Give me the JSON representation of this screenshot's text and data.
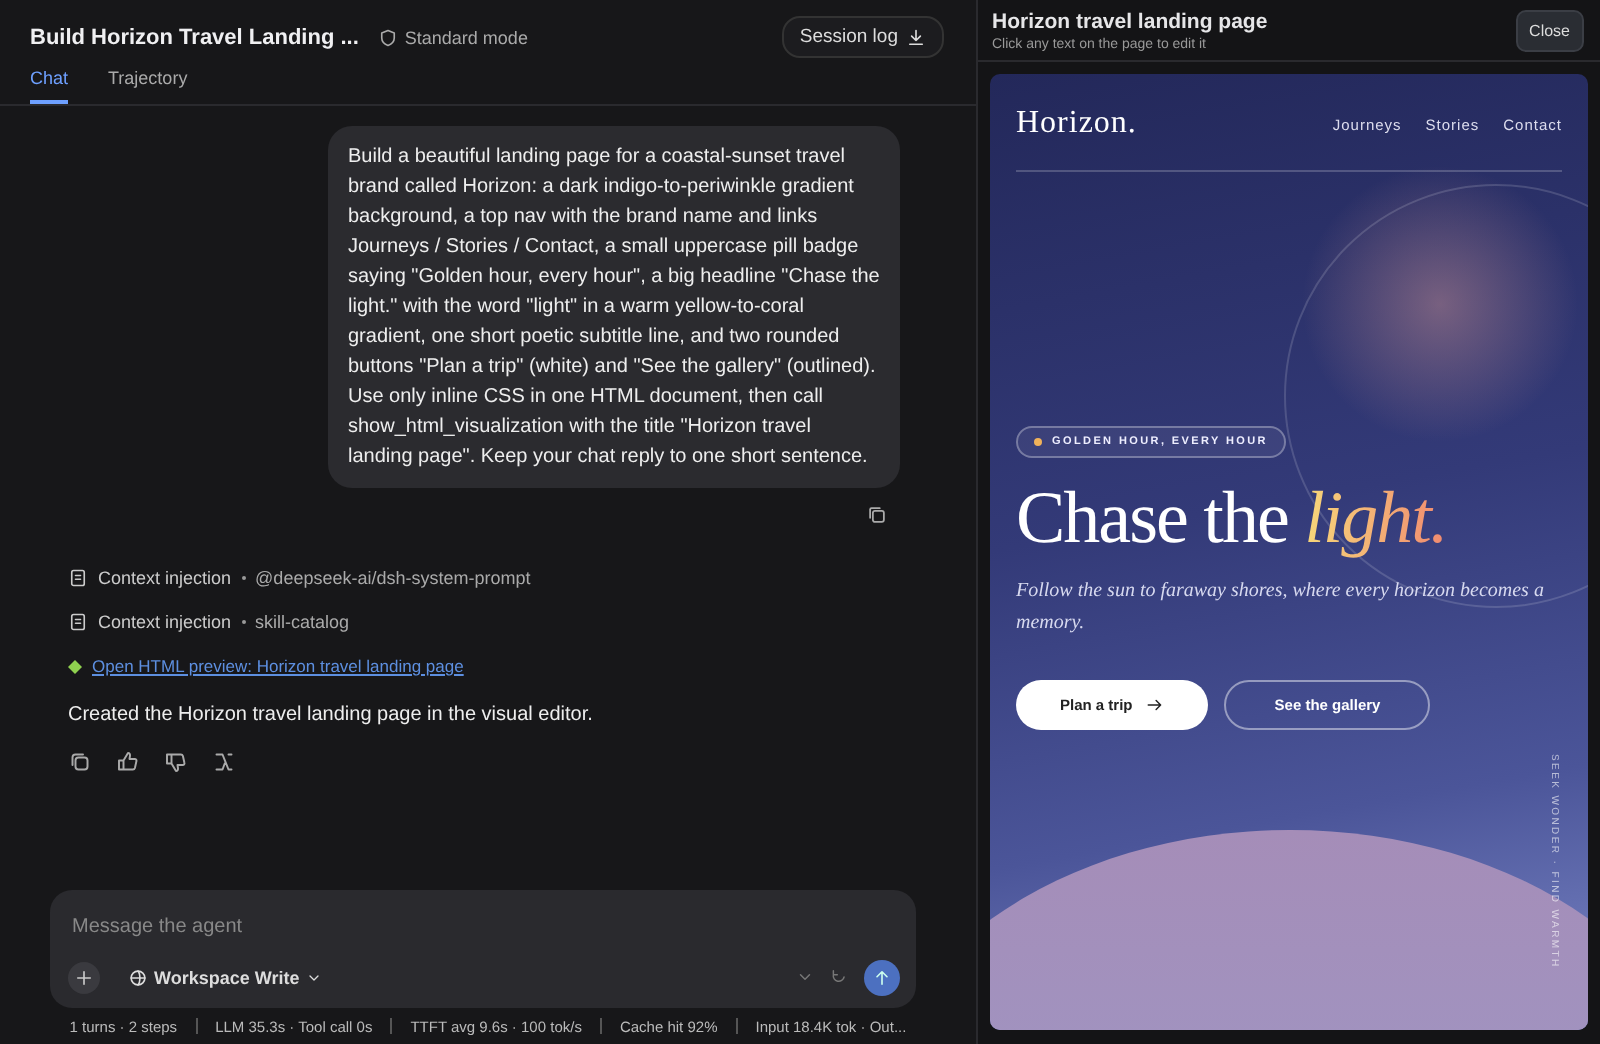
{
  "header": {
    "title": "Build Horizon Travel Landing ...",
    "mode": "Standard mode",
    "session_log": "Session log"
  },
  "tabs": [
    {
      "label": "Chat",
      "selected": true
    },
    {
      "label": "Trajectory",
      "selected": false
    }
  ],
  "user_message": "Build a beautiful landing page for a coastal-sunset travel brand called Horizon: a dark indigo-to-periwinkle gradient background, a top nav with the brand name and links Journeys / Stories / Contact, a small uppercase pill badge saying \"Golden hour, every hour\", a big headline \"Chase the light.\" with the word \"light\" in a warm yellow-to-coral gradient, one short poetic subtitle line, and two rounded buttons \"Plan a trip\" (white) and \"See the gallery\" (outlined). Use only inline CSS in one HTML document, then call show_html_visualization with the title \"Horizon travel landing page\". Keep your chat reply to one short sentence.",
  "events": [
    {
      "kind": "context",
      "label": "Context injection",
      "detail": "@deepseek-ai/dsh-system-prompt"
    },
    {
      "kind": "context",
      "label": "Context injection",
      "detail": "skill-catalog"
    },
    {
      "kind": "link",
      "label": "Open HTML preview: Horizon travel landing page"
    }
  ],
  "reply": "Created the Horizon travel landing page in the visual editor.",
  "composer": {
    "placeholder": "Message the agent",
    "mode": "Workspace Write"
  },
  "stats": [
    "1 turns · 2 steps",
    "LLM 35.3s · Tool call 0s",
    "TTFT avg 9.6s · 100 tok/s",
    "Cache hit 92%",
    "Input 18.4K tok · Out..."
  ],
  "preview": {
    "title": "Horizon travel landing page",
    "subtitle": "Click any text on the page to edit it",
    "close": "Close",
    "brand": "Horizon.",
    "nav": [
      "Journeys",
      "Stories",
      "Contact"
    ],
    "badge": "GOLDEN HOUR, EVERY HOUR",
    "headline": "Chase the *light.*",
    "tagline": "Follow the sun to faraway shores, where every horizon becomes a memory.",
    "primary_button": "Plan a trip",
    "secondary_button": "See the gallery",
    "side_text": "SEEK WONDER · FIND WARMTH"
  }
}
